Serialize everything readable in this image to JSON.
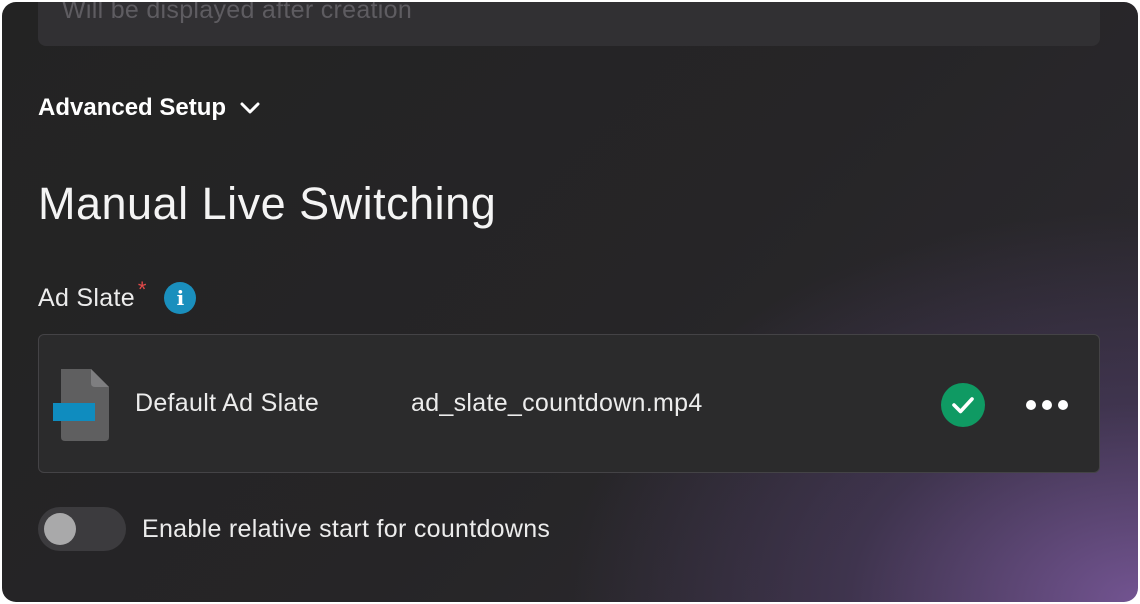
{
  "top_field": {
    "placeholder": "Will be displayed after creation"
  },
  "advanced_setup": {
    "label": "Advanced Setup",
    "icon": "chevron-down-icon"
  },
  "section": {
    "title": "Manual Live Switching"
  },
  "ad_slate": {
    "label": "Ad Slate",
    "required_mark": "*",
    "info_icon": "info-icon",
    "info_glyph": "i",
    "item": {
      "name": "Default Ad Slate",
      "filename": "ad_slate_countdown.mp4",
      "status_icon": "check-circle-icon",
      "menu_icon": "more-horizontal-icon"
    }
  },
  "relative_start": {
    "label": "Enable relative start for countdowns",
    "enabled": false
  },
  "colors": {
    "accent_info": "#1a8fbd",
    "success": "#0f9a63",
    "required": "#e34949",
    "file_accent": "#0f8cbf"
  }
}
